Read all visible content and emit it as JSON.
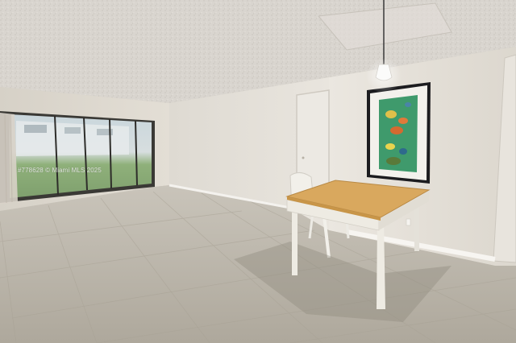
{
  "photo": {
    "watermark": "#778628 © Miami MLS 2025"
  },
  "colors": {
    "ceiling": "#dcd8d2",
    "wall": "#e5e1da",
    "floor": "#bdb7ab",
    "table_top": "#d9a85e",
    "table_frame": "#eeebe3",
    "artwork_bg": "#3f9a6c",
    "frame": "#1c1c1f"
  }
}
